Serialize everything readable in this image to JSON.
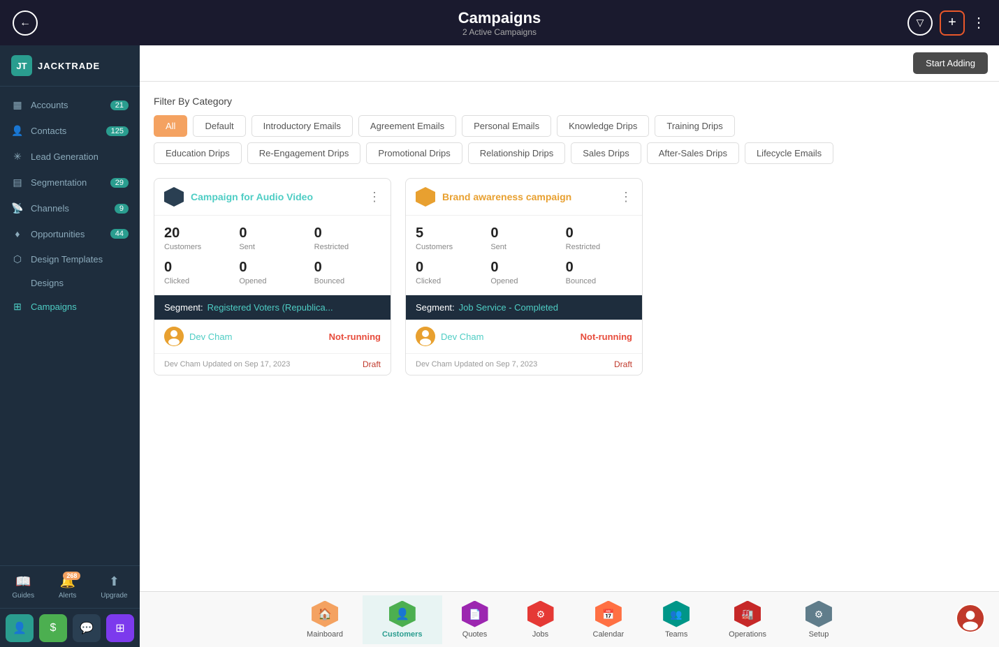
{
  "header": {
    "back_label": "←",
    "title": "Campaigns",
    "subtitle": "2 Active Campaigns",
    "filter_icon": "▽",
    "add_icon": "+",
    "more_icon": "⋮"
  },
  "sidebar": {
    "logo_text": "JACKTRADE",
    "nav_items": [
      {
        "id": "accounts",
        "label": "Accounts",
        "icon": "▦",
        "badge": "21"
      },
      {
        "id": "contacts",
        "label": "Contacts",
        "icon": "👤",
        "badge": "125"
      },
      {
        "id": "lead-generation",
        "label": "Lead Generation",
        "icon": "✳",
        "badge": ""
      },
      {
        "id": "segmentation",
        "label": "Segmentation",
        "icon": "▤",
        "badge": "29"
      },
      {
        "id": "channels",
        "label": "Channels",
        "icon": "📡",
        "badge": "9"
      },
      {
        "id": "opportunities",
        "label": "Opportunities",
        "icon": "♦",
        "badge": "44"
      },
      {
        "id": "design-templates",
        "label": "Design Templates",
        "icon": "⬡",
        "badge": ""
      },
      {
        "id": "designs",
        "label": "Designs",
        "icon": "",
        "badge": ""
      },
      {
        "id": "campaigns",
        "label": "Campaigns",
        "icon": "⊞",
        "badge": ""
      }
    ],
    "bottom_items": [
      {
        "id": "guides",
        "label": "Guides",
        "icon": "📖",
        "badge": ""
      },
      {
        "id": "alerts",
        "label": "Alerts",
        "icon": "🔔",
        "badge": "268"
      },
      {
        "id": "upgrade",
        "label": "Upgrade",
        "icon": "⬆",
        "badge": ""
      }
    ],
    "bottom_icons": [
      {
        "id": "user-icon",
        "icon": "👤",
        "color": "teal"
      },
      {
        "id": "dollar-icon",
        "icon": "$",
        "color": "green"
      },
      {
        "id": "chat-icon",
        "icon": "💬",
        "color": "dark"
      },
      {
        "id": "network-icon",
        "icon": "⊞",
        "color": "purple"
      }
    ]
  },
  "content": {
    "start_adding_label": "Start Adding",
    "filter_section_label": "Filter By Category",
    "filter_categories_row1": [
      {
        "id": "all",
        "label": "All",
        "active": true
      },
      {
        "id": "default",
        "label": "Default",
        "active": false
      },
      {
        "id": "introductory-emails",
        "label": "Introductory Emails",
        "active": false
      },
      {
        "id": "agreement-emails",
        "label": "Agreement Emails",
        "active": false
      },
      {
        "id": "personal-emails",
        "label": "Personal Emails",
        "active": false
      },
      {
        "id": "knowledge-drips",
        "label": "Knowledge Drips",
        "active": false
      },
      {
        "id": "training-drips",
        "label": "Training Drips",
        "active": false
      }
    ],
    "filter_categories_row2": [
      {
        "id": "education-drips",
        "label": "Education Drips",
        "active": false
      },
      {
        "id": "re-engagement-drips",
        "label": "Re-Engagement Drips",
        "active": false
      },
      {
        "id": "promotional-drips",
        "label": "Promotional Drips",
        "active": false
      },
      {
        "id": "relationship-drips",
        "label": "Relationship Drips",
        "active": false
      },
      {
        "id": "sales-drips",
        "label": "Sales Drips",
        "active": false
      },
      {
        "id": "after-sales-drips",
        "label": "After-Sales Drips",
        "active": false
      },
      {
        "id": "lifecycle-emails",
        "label": "Lifecycle Emails",
        "active": false
      }
    ],
    "campaigns": [
      {
        "id": "campaign-1",
        "title": "Campaign for Audio Video",
        "icon_color": "teal",
        "title_color": "teal",
        "stats": [
          {
            "value": "20",
            "label": "Customers"
          },
          {
            "value": "0",
            "label": "Sent"
          },
          {
            "value": "0",
            "label": "Restricted"
          },
          {
            "value": "0",
            "label": "Clicked"
          },
          {
            "value": "0",
            "label": "Opened"
          },
          {
            "value": "0",
            "label": "Bounced"
          }
        ],
        "segment_label": "Segment:",
        "segment_value": "Registered Voters (Republica...",
        "user_name": "Dev Cham",
        "status": "Not-running",
        "updated_text": "Dev Cham Updated on Sep 17, 2023",
        "draft_label": "Draft"
      },
      {
        "id": "campaign-2",
        "title": "Brand awareness campaign",
        "icon_color": "orange",
        "title_color": "orange",
        "stats": [
          {
            "value": "5",
            "label": "Customers"
          },
          {
            "value": "0",
            "label": "Sent"
          },
          {
            "value": "0",
            "label": "Restricted"
          },
          {
            "value": "0",
            "label": "Clicked"
          },
          {
            "value": "0",
            "label": "Opened"
          },
          {
            "value": "0",
            "label": "Bounced"
          }
        ],
        "segment_label": "Segment:",
        "segment_value": "Job Service - Completed",
        "user_name": "Dev Cham",
        "status": "Not-running",
        "updated_text": "Dev Cham Updated on Sep 7, 2023",
        "draft_label": "Draft"
      }
    ]
  },
  "bottom_nav": {
    "items": [
      {
        "id": "mainboard",
        "label": "Mainboard",
        "icon": "🏠",
        "color": "yellow",
        "active": false
      },
      {
        "id": "customers",
        "label": "Customers",
        "icon": "👤",
        "color": "green",
        "active": true
      },
      {
        "id": "quotes",
        "label": "Quotes",
        "icon": "📄",
        "color": "purple",
        "active": false
      },
      {
        "id": "jobs",
        "label": "Jobs",
        "icon": "⚙",
        "color": "red",
        "active": false
      },
      {
        "id": "calendar",
        "label": "Calendar",
        "icon": "📅",
        "color": "orange",
        "active": false
      },
      {
        "id": "teams",
        "label": "Teams",
        "icon": "👥",
        "color": "teal",
        "active": false
      },
      {
        "id": "operations",
        "label": "Operations",
        "icon": "🏭",
        "color": "dark-red",
        "active": false
      },
      {
        "id": "setup",
        "label": "Setup",
        "icon": "⚙",
        "color": "gray",
        "active": false
      }
    ]
  }
}
